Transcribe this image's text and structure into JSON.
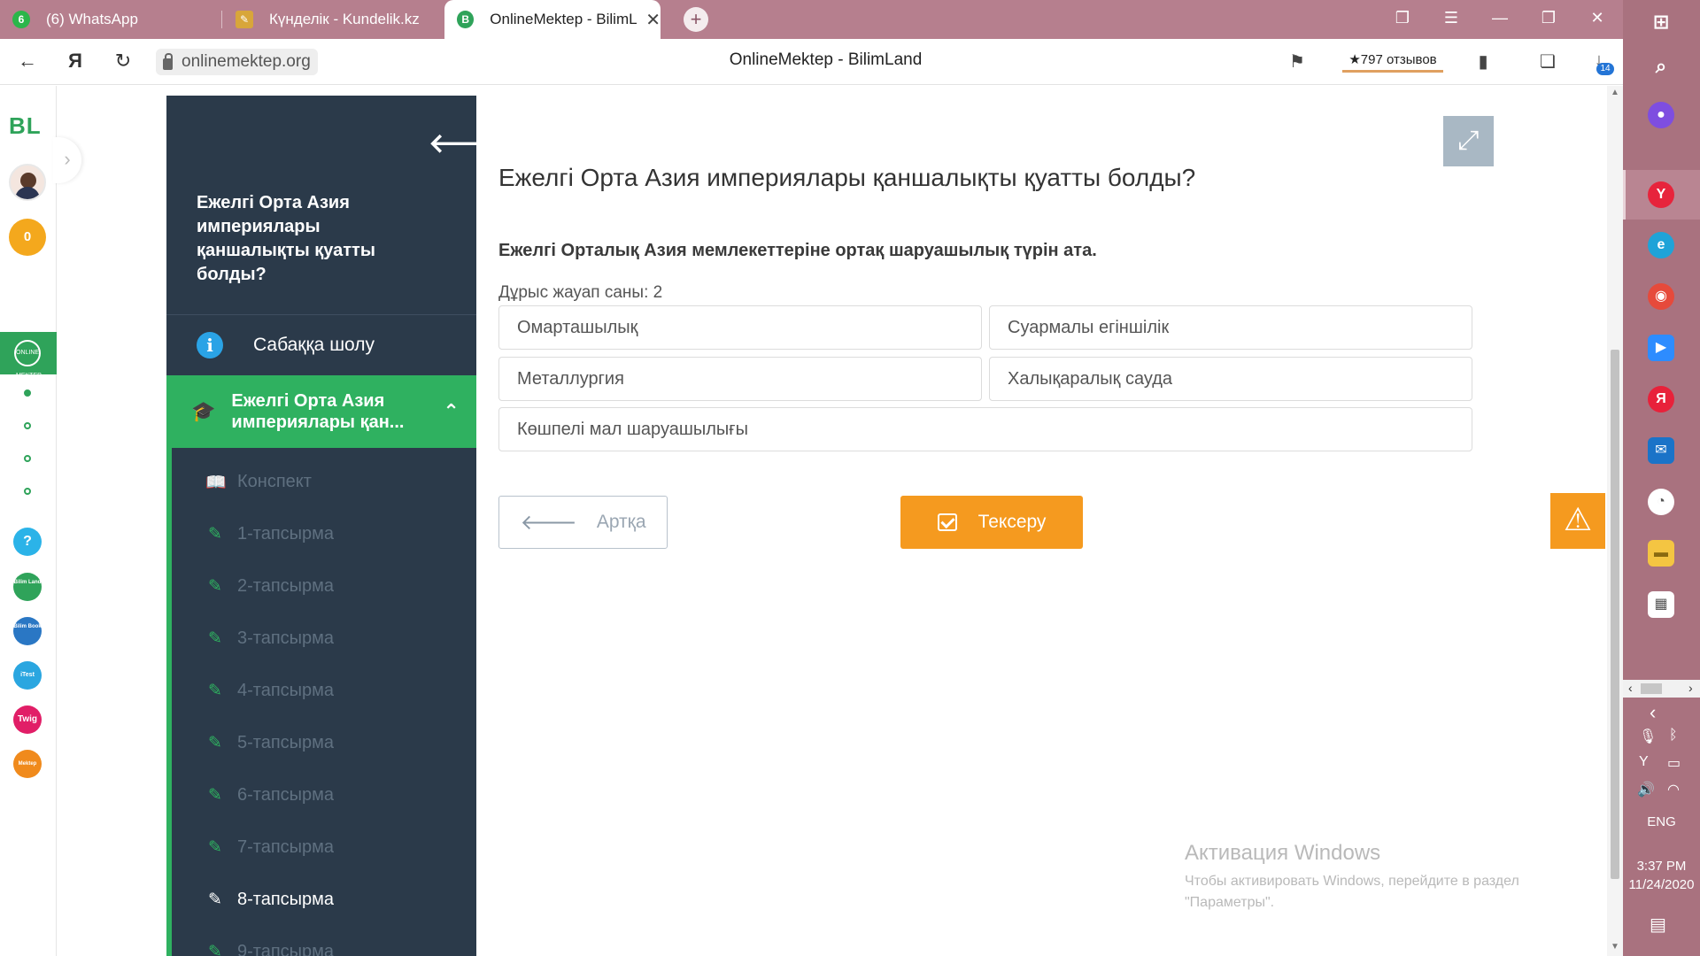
{
  "browser": {
    "tabs": [
      {
        "label": "(6) WhatsApp",
        "icon": "whatsapp-icon"
      },
      {
        "label": "Күнделік - Kundelik.kz",
        "icon": "kundelik-icon"
      },
      {
        "label": "OnlineMektep - BilimLa",
        "icon": "onlinemektep-icon",
        "close": "✕"
      }
    ],
    "new_tab": "+",
    "url": "onlinemektep.org",
    "page_title": "OnlineMektep - BilimLand",
    "reviews": "★797 отзывов",
    "download_count": "14",
    "accent_color": "#b67f8e"
  },
  "rail": {
    "logo": "BL",
    "coins": "0",
    "active_logo": "ONLINE MEKTEP",
    "apps": [
      {
        "label": "?",
        "color": "#2bb3e8"
      },
      {
        "label": "Bilim Land",
        "color": "#2fa35a"
      },
      {
        "label": "Bilim Book",
        "color": "#2a77c4"
      },
      {
        "label": "iTest",
        "color": "#2aa6e0"
      },
      {
        "label": "Twig",
        "color": "#e11e67"
      },
      {
        "label": "Mektep",
        "color": "#f08a1c"
      }
    ]
  },
  "sidebar": {
    "course_title": "Ежелгі Орта Азия империялары қаншалықты қуатты болды?",
    "overview_label": "Сабаққа шолу",
    "active_section": "Ежелгі Орта Азия империялары қан...",
    "items": [
      {
        "label": "Конспект"
      },
      {
        "label": "1-тапсырма"
      },
      {
        "label": "2-тапсырма"
      },
      {
        "label": "3-тапсырма"
      },
      {
        "label": "4-тапсырма"
      },
      {
        "label": "5-тапсырма"
      },
      {
        "label": "6-тапсырма"
      },
      {
        "label": "7-тапсырма"
      },
      {
        "label": "8-тапсырма"
      },
      {
        "label": "9-тапсырма"
      }
    ],
    "current_item": "8-тапсырма",
    "color_active": "#2fb160",
    "color_bg": "#2b3a4a"
  },
  "quiz": {
    "title": "Ежелгі Орта Азия империялары қаншалықты қуатты болды?",
    "question": "Ежелгі Орталық Азия мемлекеттеріне ортақ шаруашылық түрін ата.",
    "answer_count": "Дұрыс жауап саны: 2",
    "options": [
      "Омарташылық",
      "Суармалы егіншілік",
      "Металлургия",
      "Халықаралық сауда",
      "Көшпелі мал шаруашылығы"
    ],
    "back_label": "Артқа",
    "check_label": "Тексеру",
    "check_color": "#f59a1f"
  },
  "activation": {
    "title": "Активация Windows",
    "text": "Чтобы активировать Windows, перейдите в раздел \"Параметры\"."
  },
  "taskbar": {
    "language": "ENG",
    "time": "3:37 PM",
    "date": "11/24/2020"
  }
}
